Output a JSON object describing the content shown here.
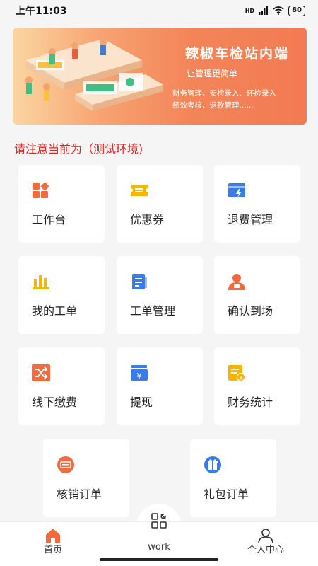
{
  "status_bar": {
    "time": "上午11:03",
    "network_label": "HD",
    "battery": "80"
  },
  "banner": {
    "title": "辣椒车检站内端",
    "subtitle": "让管理更简单",
    "desc_line1": "财务管理、安检录入、环检录入",
    "desc_line2": "绩效考核、退款管理......"
  },
  "notice": "请注意当前为（测试环境)",
  "menu": [
    {
      "label": "工作台"
    },
    {
      "label": "优惠券"
    },
    {
      "label": "退费管理"
    },
    {
      "label": "我的工单"
    },
    {
      "label": "工单管理"
    },
    {
      "label": "确认到场"
    },
    {
      "label": "线下缴费"
    },
    {
      "label": "提现"
    },
    {
      "label": "财务统计"
    },
    {
      "label": "核销订单"
    },
    {
      "label": "礼包订单"
    }
  ],
  "bottom_nav": {
    "home": "首页",
    "work": "work",
    "profile": "个人中心"
  },
  "colors": {
    "accent_orange": "#f26a3d",
    "accent_yellow": "#f7b500",
    "accent_blue": "#3a7bea",
    "notice_red": "#d7261f"
  }
}
